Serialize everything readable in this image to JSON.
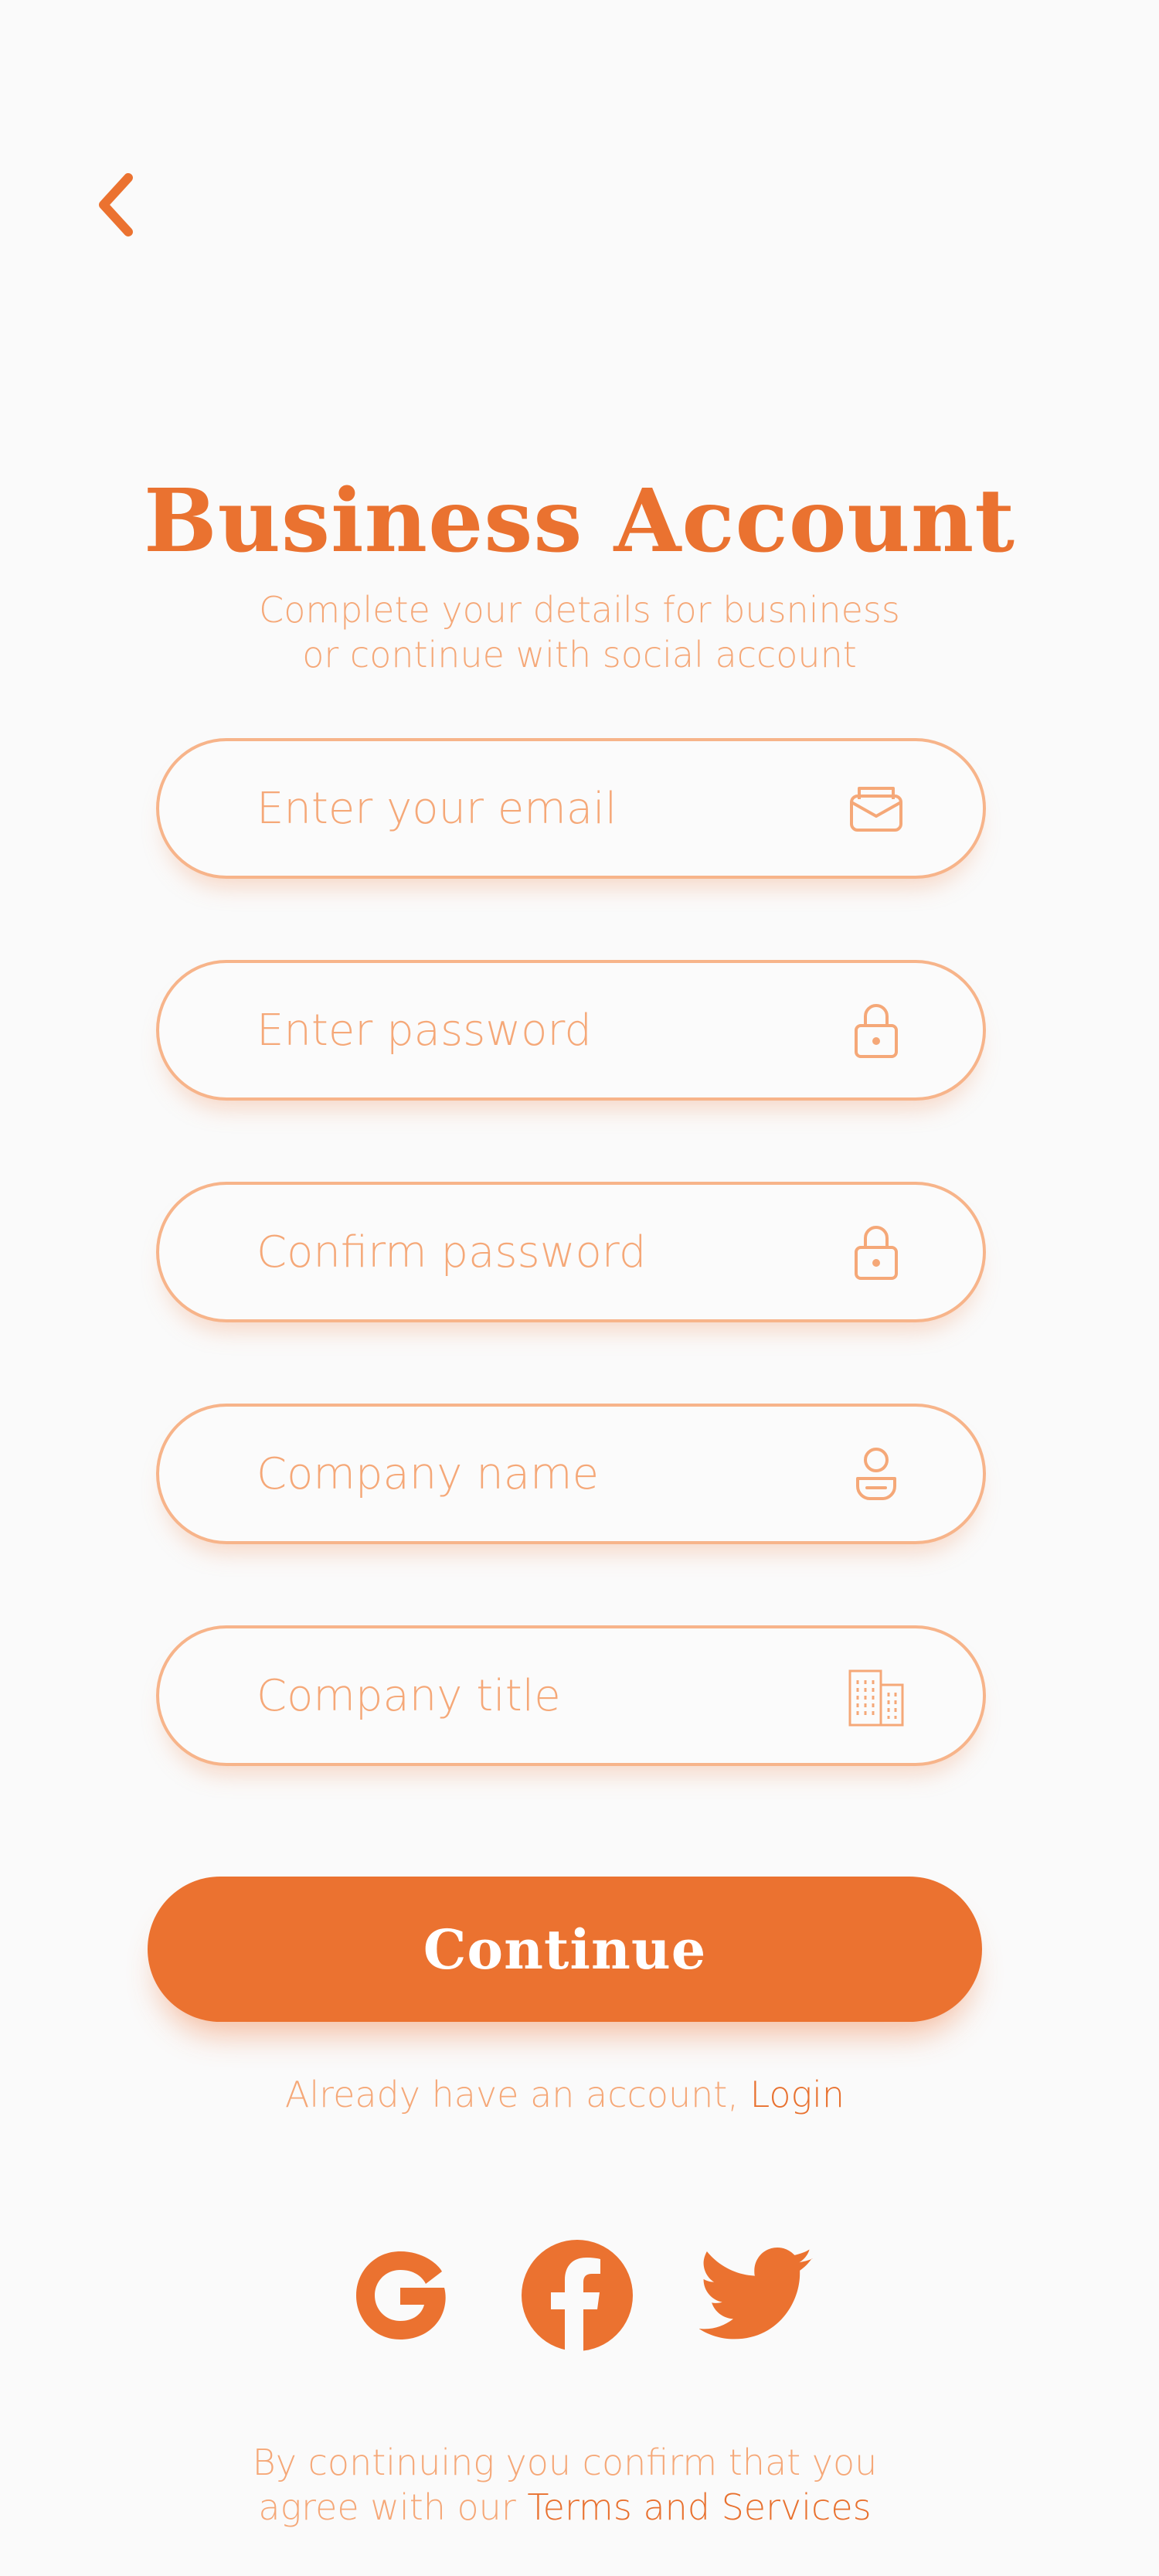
{
  "header": {
    "back_icon": "chevron-left-icon",
    "title": "Business Account",
    "subtitle_line1": "Complete your details for busniness",
    "subtitle_line2": "or continue with social account"
  },
  "form": {
    "email": {
      "placeholder": "Enter your email",
      "value": "",
      "icon": "mail-icon"
    },
    "password": {
      "placeholder": "Enter password",
      "value": "",
      "icon": "lock-icon"
    },
    "confirm_password": {
      "placeholder": "Confirm password",
      "value": "",
      "icon": "lock-icon"
    },
    "company_name": {
      "placeholder": "Company name",
      "value": "",
      "icon": "user-icon"
    },
    "company_title": {
      "placeholder": "Company title",
      "value": "",
      "icon": "building-icon"
    }
  },
  "actions": {
    "continue_label": "Continue",
    "login_prompt": "Already have an account, ",
    "login_link": "Login"
  },
  "social": {
    "items": [
      "google-icon",
      "facebook-icon",
      "twitter-icon"
    ]
  },
  "footer": {
    "line1": "By continuing you confirm that you",
    "line2_prefix": "agree with our ",
    "terms_link": "Terms and Services"
  },
  "colors": {
    "accent": "#eb7230",
    "muted": "#f5a878",
    "border": "#f7b48a",
    "background": "#fafafa"
  }
}
